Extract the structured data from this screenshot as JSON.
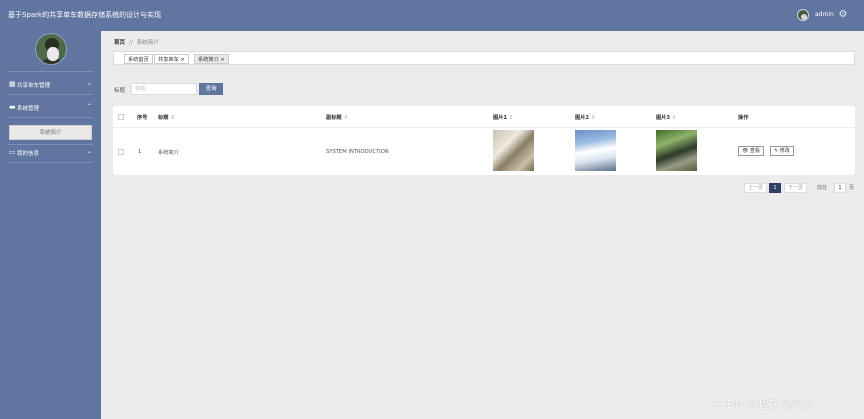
{
  "header": {
    "app_title": "基于Spark的共享单车数据存储系统的设计与实现",
    "admin_name": "admin",
    "settings_icon": "gear-icon"
  },
  "sidebar": {
    "items": [
      {
        "label": "共享单车管理",
        "icon": "grid-icon",
        "arrow": "chevron-down-icon"
      },
      {
        "label": "系统管理",
        "icon": "monitor-icon",
        "arrow": "chevron-up-icon",
        "sub_items": [
          "系统简介"
        ]
      },
      {
        "label": "我的信息",
        "icon": "card-icon",
        "arrow": "chevron-down-icon"
      }
    ]
  },
  "breadcrumb": {
    "home": "首页",
    "separator": "//",
    "current": "系统简介"
  },
  "tabs": [
    {
      "label": "系统首页",
      "closable": false
    },
    {
      "label": "共享单车 ×",
      "closable": true
    },
    {
      "label": "系统简介 ×",
      "closable": true,
      "active": true
    }
  ],
  "search": {
    "label": "标题",
    "placeholder": "标题",
    "button": "查询"
  },
  "table": {
    "columns": [
      "序号",
      "标题",
      "副标题",
      "图片1",
      "图片2",
      "图片3",
      "操作"
    ],
    "sort_glyph": "⇕",
    "rows": [
      {
        "index": "1",
        "title": "系统简介",
        "subtitle": "SYSTEM INTRODUCTION",
        "images": [
          "interior-photo",
          "snow-mountain-photo",
          "garden-photo"
        ],
        "actions": [
          "查看",
          "修改"
        ]
      }
    ]
  },
  "pagination": {
    "prev": "上一页",
    "current": "1",
    "next": "下一页",
    "goto_label": "前往",
    "goto_value": "1",
    "page_suffix": "页"
  },
  "watermark": "CSDN @程序员阿龙"
}
